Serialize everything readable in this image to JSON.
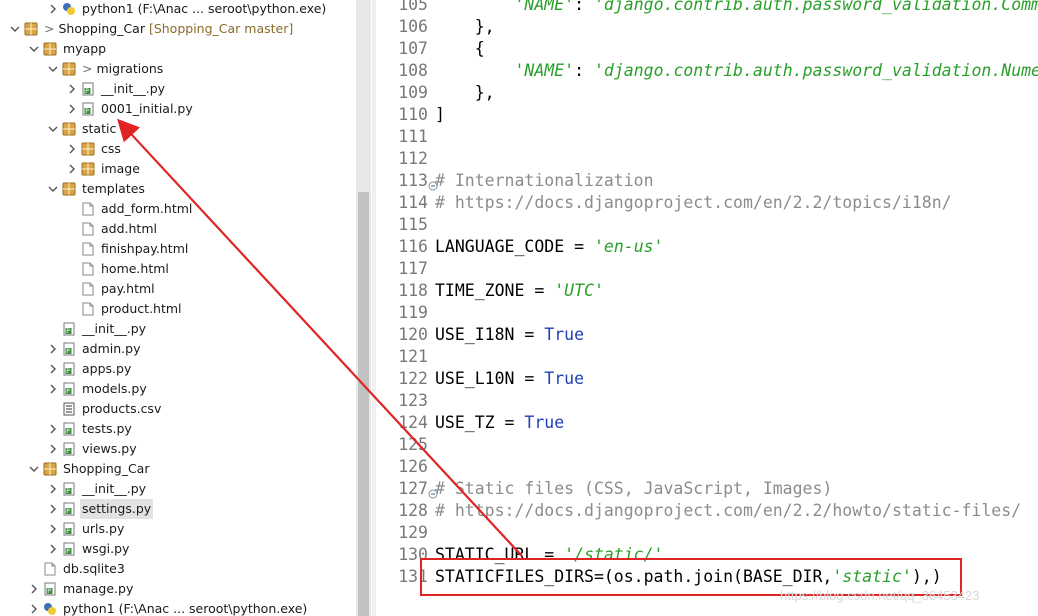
{
  "tree": {
    "rows": [
      {
        "label": "python1   (F:\\Anac ... seroot\\python.exe)",
        "depth": 2,
        "icon": "python",
        "arrow": "right"
      },
      {
        "label": "Shopping_Car",
        "deco": "[Shopping_Car master]",
        "prefix": ">",
        "depth": 0,
        "icon": "project",
        "arrow": "down"
      },
      {
        "label": "myapp",
        "depth": 1,
        "icon": "package",
        "arrow": "down"
      },
      {
        "label": "migrations",
        "prefix": ">",
        "depth": 2,
        "icon": "package",
        "arrow": "down"
      },
      {
        "label": "__init__.py",
        "depth": 3,
        "icon": "pyfile",
        "arrow": "right"
      },
      {
        "label": "0001_initial.py",
        "depth": 3,
        "icon": "pyfile",
        "arrow": "right"
      },
      {
        "label": "static",
        "depth": 2,
        "icon": "package",
        "arrow": "down"
      },
      {
        "label": "css",
        "depth": 3,
        "icon": "package",
        "arrow": "right"
      },
      {
        "label": "image",
        "depth": 3,
        "icon": "package",
        "arrow": "right"
      },
      {
        "label": "templates",
        "depth": 2,
        "icon": "package",
        "arrow": "down"
      },
      {
        "label": "add_form.html",
        "depth": 3,
        "icon": "file",
        "arrow": "none"
      },
      {
        "label": "add.html",
        "depth": 3,
        "icon": "file",
        "arrow": "none"
      },
      {
        "label": "finishpay.html",
        "depth": 3,
        "icon": "file",
        "arrow": "none"
      },
      {
        "label": "home.html",
        "depth": 3,
        "icon": "file",
        "arrow": "none"
      },
      {
        "label": "pay.html",
        "depth": 3,
        "icon": "file",
        "arrow": "none"
      },
      {
        "label": "product.html",
        "depth": 3,
        "icon": "file",
        "arrow": "none"
      },
      {
        "label": "__init__.py",
        "depth": 2,
        "icon": "pyfile",
        "arrow": "none"
      },
      {
        "label": "admin.py",
        "depth": 2,
        "icon": "pyfile",
        "arrow": "right"
      },
      {
        "label": "apps.py",
        "depth": 2,
        "icon": "pyfile",
        "arrow": "right"
      },
      {
        "label": "models.py",
        "depth": 2,
        "icon": "pyfile",
        "arrow": "right"
      },
      {
        "label": "products.csv",
        "depth": 2,
        "icon": "csvfile",
        "arrow": "none"
      },
      {
        "label": "tests.py",
        "depth": 2,
        "icon": "pyfile",
        "arrow": "right"
      },
      {
        "label": "views.py",
        "depth": 2,
        "icon": "pyfile",
        "arrow": "right"
      },
      {
        "label": "Shopping_Car",
        "depth": 1,
        "icon": "package",
        "arrow": "down"
      },
      {
        "label": "__init__.py",
        "depth": 2,
        "icon": "pyfile",
        "arrow": "right"
      },
      {
        "label": "settings.py",
        "depth": 2,
        "icon": "pyfile",
        "arrow": "right",
        "selected": true
      },
      {
        "label": "urls.py",
        "depth": 2,
        "icon": "pyfile",
        "arrow": "right"
      },
      {
        "label": "wsgi.py",
        "depth": 2,
        "icon": "pyfile",
        "arrow": "right"
      },
      {
        "label": "db.sqlite3",
        "depth": 1,
        "icon": "file",
        "arrow": "none"
      },
      {
        "label": "manage.py",
        "depth": 1,
        "icon": "pyfile",
        "arrow": "right"
      },
      {
        "label": "python1   (F:\\Anac ... seroot\\python.exe)",
        "depth": 1,
        "icon": "python",
        "arrow": "right"
      }
    ]
  },
  "editor": {
    "lines": [
      {
        "n": "105",
        "fold": false,
        "parts": [
          [
            "",
            "        "
          ],
          [
            "str",
            "'NAME'"
          ],
          [
            "",
            ": "
          ],
          [
            "str",
            "'django.contrib.auth.password_validation.Comm"
          ]
        ]
      },
      {
        "n": "106",
        "fold": false,
        "parts": [
          [
            "",
            "    },"
          ]
        ]
      },
      {
        "n": "107",
        "fold": false,
        "parts": [
          [
            "",
            "    {"
          ]
        ]
      },
      {
        "n": "108",
        "fold": false,
        "parts": [
          [
            "",
            "        "
          ],
          [
            "str",
            "'NAME'"
          ],
          [
            "",
            ": "
          ],
          [
            "str",
            "'django.contrib.auth.password_validation.Nume"
          ]
        ]
      },
      {
        "n": "109",
        "fold": false,
        "parts": [
          [
            "",
            "    },"
          ]
        ]
      },
      {
        "n": "110",
        "fold": false,
        "parts": [
          [
            "",
            "]"
          ]
        ]
      },
      {
        "n": "111",
        "fold": false,
        "parts": []
      },
      {
        "n": "112",
        "fold": false,
        "parts": []
      },
      {
        "n": "113",
        "fold": true,
        "parts": [
          [
            "cmt",
            "# Internationalization"
          ]
        ]
      },
      {
        "n": "114",
        "fold": false,
        "parts": [
          [
            "cmt",
            "# https://docs.djangoproject.com/en/2.2/topics/i18n/"
          ]
        ]
      },
      {
        "n": "115",
        "fold": false,
        "parts": []
      },
      {
        "n": "116",
        "fold": false,
        "parts": [
          [
            "",
            "LANGUAGE_CODE = "
          ],
          [
            "str",
            "'en-us'"
          ]
        ]
      },
      {
        "n": "117",
        "fold": false,
        "parts": []
      },
      {
        "n": "118",
        "fold": false,
        "parts": [
          [
            "",
            "TIME_ZONE = "
          ],
          [
            "str",
            "'UTC'"
          ]
        ]
      },
      {
        "n": "119",
        "fold": false,
        "parts": []
      },
      {
        "n": "120",
        "fold": false,
        "parts": [
          [
            "",
            "USE_I18N = "
          ],
          [
            "kw",
            "True"
          ]
        ]
      },
      {
        "n": "121",
        "fold": false,
        "parts": []
      },
      {
        "n": "122",
        "fold": false,
        "parts": [
          [
            "",
            "USE_L10N = "
          ],
          [
            "kw",
            "True"
          ]
        ]
      },
      {
        "n": "123",
        "fold": false,
        "parts": []
      },
      {
        "n": "124",
        "fold": false,
        "parts": [
          [
            "",
            "USE_TZ = "
          ],
          [
            "kw",
            "True"
          ]
        ]
      },
      {
        "n": "125",
        "fold": false,
        "parts": []
      },
      {
        "n": "126",
        "fold": false,
        "parts": []
      },
      {
        "n": "127",
        "fold": true,
        "parts": [
          [
            "cmt",
            "# Static files (CSS, JavaScript, Images)"
          ]
        ]
      },
      {
        "n": "128",
        "fold": false,
        "parts": [
          [
            "cmt",
            "# https://docs.djangoproject.com/en/2.2/howto/static-files/"
          ]
        ]
      },
      {
        "n": "129",
        "fold": false,
        "parts": []
      },
      {
        "n": "130",
        "fold": false,
        "parts": [
          [
            "",
            "STATIC_URL = "
          ],
          [
            "str",
            "'/static/'"
          ]
        ]
      },
      {
        "n": "131",
        "fold": false,
        "parts": [
          [
            "",
            "STATICFILES_DIRS=(os.path.join(BASE_DIR,"
          ],
          [
            "str",
            "'static'"
          ],
          [
            "",
            "),)"
          ]
        ]
      }
    ]
  },
  "watermark": "https://blog.csdn.net/qq_36453423",
  "colors": {
    "annotation": "#e02424",
    "string": "#2a9f2a",
    "keyword": "#1f3fb5",
    "comment": "#8c8c8c"
  }
}
